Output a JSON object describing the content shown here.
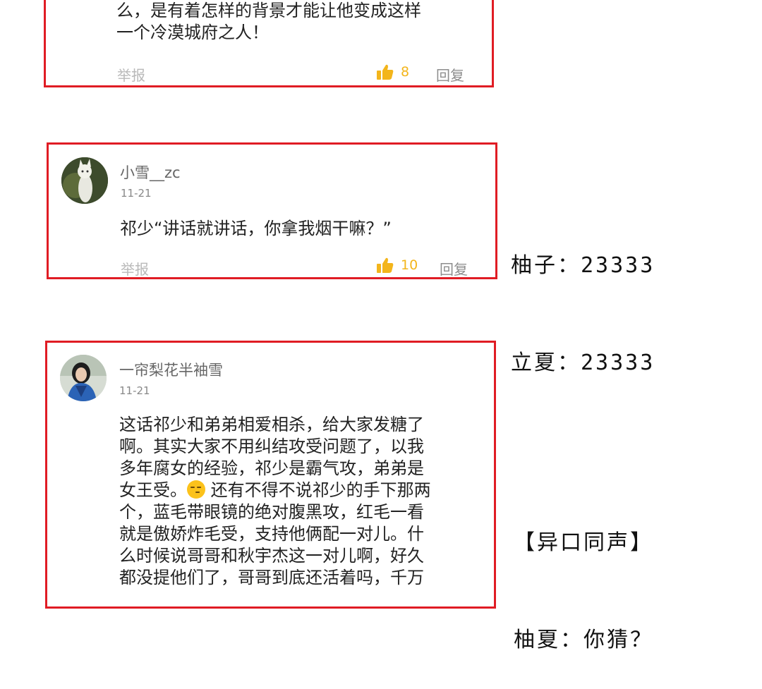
{
  "top_side_fragment": "· ·   ·  ·",
  "comments": [
    {
      "text_lines": [
        "么，是有着怎样的背景才能让他变成这样",
        "一个冷漠城府之人！"
      ],
      "report": "举报",
      "likes": "8",
      "reply": "回复"
    },
    {
      "name": "小雪__zc",
      "date": "11-21",
      "text_lines": [
        "祁少“讲话就讲话，你拿我烟干嘛？”"
      ],
      "report": "举报",
      "likes": "10",
      "reply": "回复"
    },
    {
      "name": "一帘梨花半袖雪",
      "date": "11-21",
      "text_lines": [
        "这话祁少和弟弟相爱相杀，给大家发糖了",
        "啊。其实大家不用纠结攻受问题了，以我",
        "多年腐女的经验，祁少是霸气攻，弟弟是",
        "女王受。",
        "个，蓝毛带眼镜的绝对腹黑攻，红毛一看",
        "就是傲娇炸毛受，支持他俩配一对儿。什",
        "么时候说哥哥和秋宇杰这一对儿啊，好久",
        "都没提他们了，哥哥到底还活着吗，千万"
      ],
      "text_line4_tail": "还有不得不说祁少的手下那两"
    }
  ],
  "side_notes": {
    "group1": [
      "柚子：23333",
      "立夏：23333"
    ],
    "group2": [
      "【异口同声】",
      "柚夏：你猜？"
    ]
  },
  "colors": {
    "border": "#e01c24",
    "like": "#f3b51b"
  }
}
